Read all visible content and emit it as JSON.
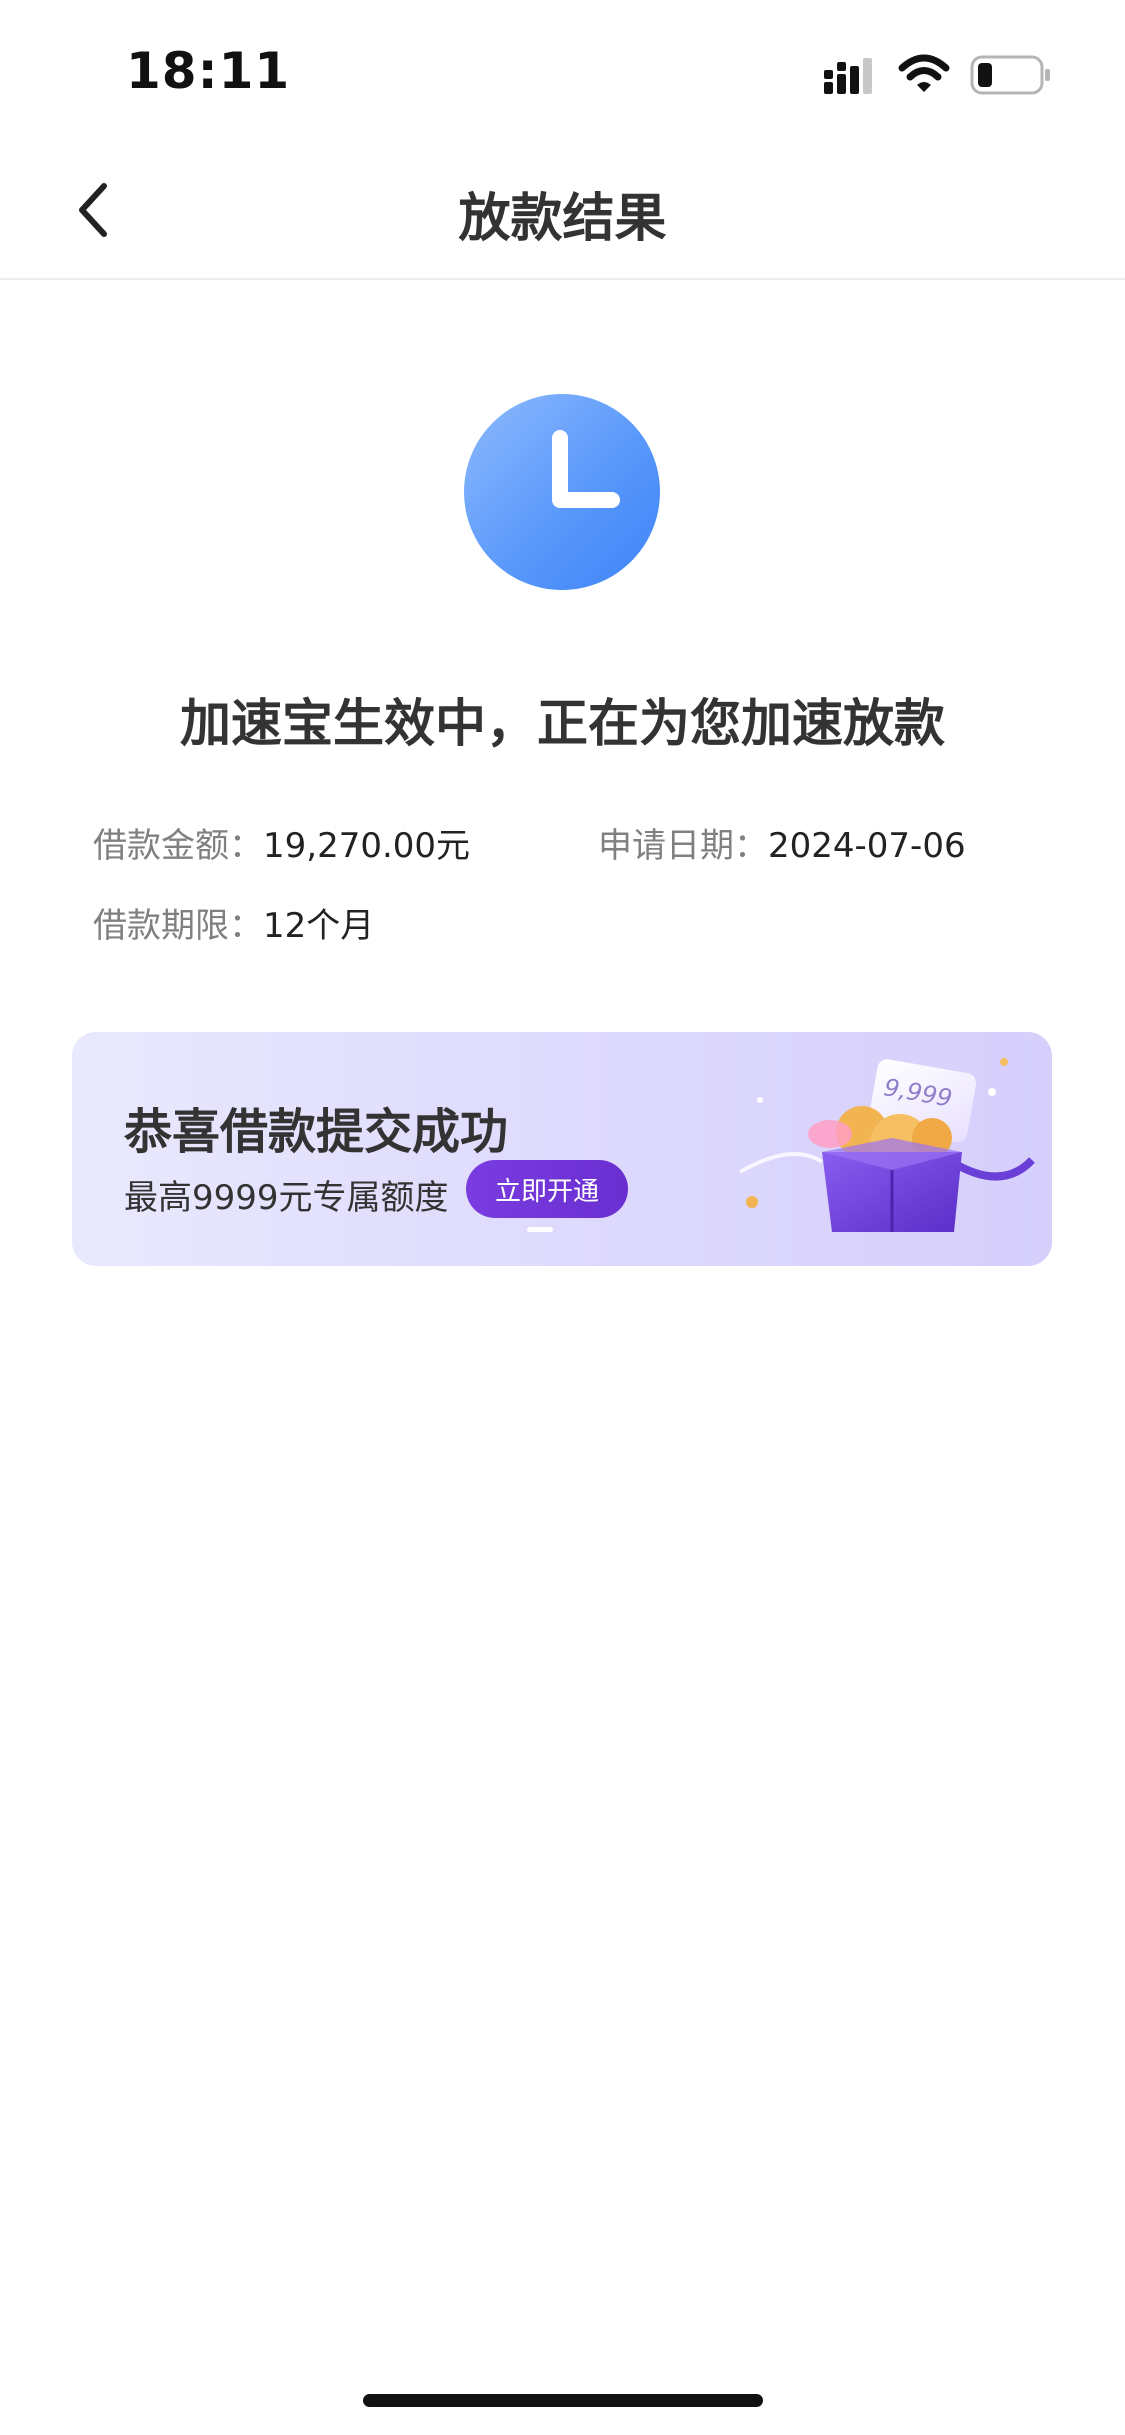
{
  "status_bar": {
    "time": "18:11"
  },
  "nav": {
    "title": "放款结果"
  },
  "result": {
    "message": "加速宝生效中，正在为您加速放款",
    "amount_label": "借款金额：",
    "amount_value": "19,270.00元",
    "date_label": "申请日期：",
    "date_value": "2024-07-06",
    "term_label": "借款期限：",
    "term_value": "12个月"
  },
  "banner": {
    "title": "恭喜借款提交成功",
    "subtitle": "最高9999元专属额度",
    "button": "立即开通",
    "gift_card_amount": "9,999"
  },
  "colors": {
    "accent_blue": "#4a8cf9",
    "banner_button": "#6a2fd0",
    "banner_bg": "#dedafd"
  }
}
